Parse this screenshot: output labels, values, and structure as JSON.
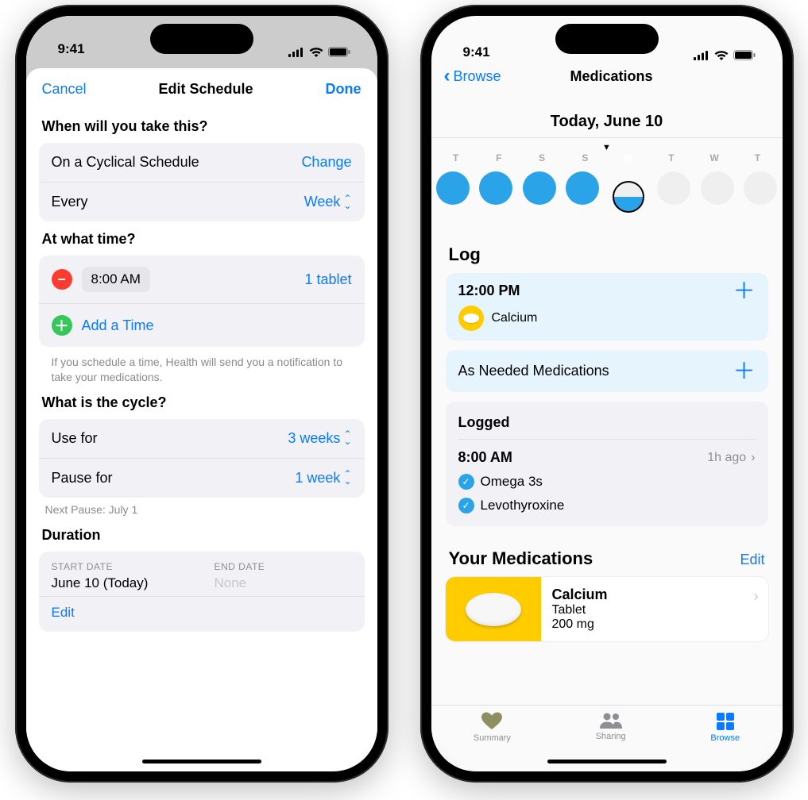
{
  "status": {
    "time": "9:41"
  },
  "left": {
    "nav": {
      "cancel": "Cancel",
      "title": "Edit Schedule",
      "done": "Done"
    },
    "sec1": {
      "heading": "When will you take this?"
    },
    "schedule": {
      "type": "On a Cyclical Schedule",
      "change": "Change",
      "every_label": "Every",
      "every_value": "Week"
    },
    "sec2": {
      "heading": "At what time?"
    },
    "times": {
      "entries": [
        {
          "time": "8:00 AM",
          "dose": "1 tablet"
        }
      ],
      "add": "Add a Time",
      "note": "If you schedule a time, Health will send you a notification to take your medications."
    },
    "sec3": {
      "heading": "What is the cycle?"
    },
    "cycle": {
      "use_label": "Use for",
      "use_value": "3 weeks",
      "pause_label": "Pause for",
      "pause_value": "1 week",
      "next": "Next Pause: July 1"
    },
    "sec4": {
      "heading": "Duration"
    },
    "duration": {
      "start_label": "START DATE",
      "start_value": "June 10 (Today)",
      "end_label": "END DATE",
      "end_value": "None",
      "edit": "Edit"
    }
  },
  "right": {
    "nav": {
      "back": "Browse",
      "title": "Medications"
    },
    "date": "Today, June 10",
    "days": [
      "T",
      "F",
      "S",
      "S",
      "M",
      "T",
      "W",
      "T"
    ],
    "log_heading": "Log",
    "log_time_card": {
      "time": "12:00 PM",
      "med": "Calcium"
    },
    "as_needed": "As Needed Medications",
    "logged": {
      "heading": "Logged",
      "time": "8:00 AM",
      "ago": "1h ago",
      "items": [
        "Omega 3s",
        "Levothyroxine"
      ]
    },
    "your_meds": {
      "heading": "Your Medications",
      "edit": "Edit"
    },
    "med_card": {
      "name": "Calcium",
      "form": "Tablet",
      "strength": "200 mg"
    },
    "tabs": {
      "summary": "Summary",
      "sharing": "Sharing",
      "browse": "Browse"
    }
  }
}
